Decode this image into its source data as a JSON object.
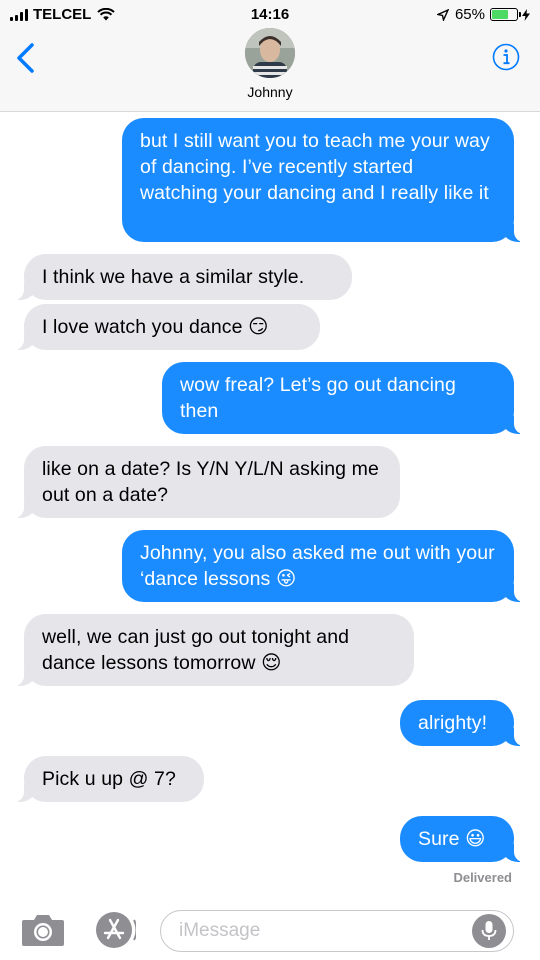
{
  "status_bar": {
    "carrier": "TELCEL",
    "time": "14:16",
    "battery_percent": "65%",
    "battery_level": 0.65
  },
  "header": {
    "contact_name": "Johnny",
    "back_icon": "chevron-left-icon",
    "info_icon": "info-icon"
  },
  "messages": [
    {
      "from": "me",
      "text": "but I still want you to teach me your way of dancing. I’ve recently started watching your dancing and I really like it"
    },
    {
      "from": "them",
      "text": "I think we have a similar style."
    },
    {
      "from": "them",
      "text": "I love watch you dance",
      "emoji": "😏"
    },
    {
      "from": "me",
      "text": "wow freal? Let’s go out dancing then"
    },
    {
      "from": "them",
      "text": "like on a date? Is Y/N Y/L/N asking me out on a date?"
    },
    {
      "from": "me",
      "text": "Johnny, you also asked me out with your ‘dance lessons",
      "emoji": "😜"
    },
    {
      "from": "them",
      "text": "well, we can just go out tonight and dance lessons tomorrow",
      "emoji": "😌"
    },
    {
      "from": "me",
      "text": "alrighty!"
    },
    {
      "from": "them",
      "text": "Pick u up @ 7?"
    },
    {
      "from": "me",
      "text": "Sure",
      "emoji": "😃"
    }
  ],
  "delivered_label": "Delivered",
  "input": {
    "placeholder": "iMessage",
    "camera_icon": "camera-icon",
    "apps_icon": "app-store-icon",
    "mic_icon": "microphone-icon"
  },
  "colors": {
    "sent_bubble": "#1a8cff",
    "received_bubble": "#e5e5ea",
    "accent": "#007aff"
  }
}
